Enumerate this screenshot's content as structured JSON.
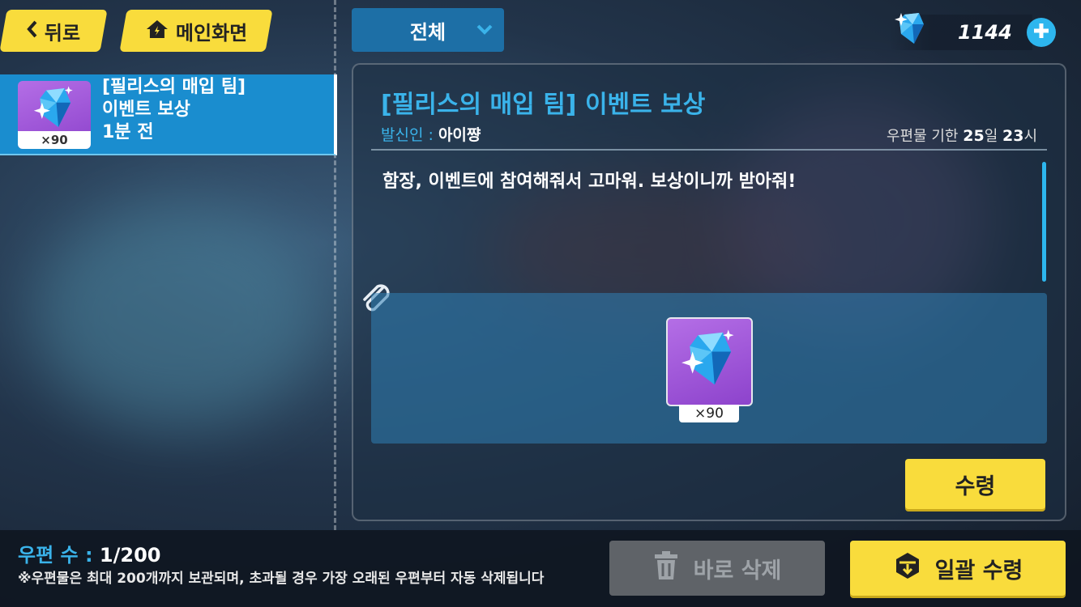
{
  "nav": {
    "back_label": "뒤로",
    "home_label": "메인화면"
  },
  "filter": {
    "selected": "전체"
  },
  "currency": {
    "amount": "1144",
    "icon": "crystal-icon"
  },
  "mail_list": [
    {
      "title_line1": "[필리스의 매입 팀]",
      "title_line2": "이벤트 보상",
      "time": "1분 전",
      "quantity": "×90",
      "icon": "crystal-icon"
    }
  ],
  "detail": {
    "title": "[필리스의 매입 팀] 이벤트 보상",
    "sender_label": "발신인 :",
    "sender_name": "아이쨩",
    "expire_prefix": "우편물 기한",
    "expire_days": "25",
    "expire_day_unit": "일",
    "expire_hours": "23",
    "expire_hour_unit": "시",
    "message": "함장, 이벤트에 참여해줘서 고마워. 보상이니까 받아줘!",
    "attachment": {
      "quantity": "×90",
      "icon": "crystal-icon"
    },
    "claim_label": "수령"
  },
  "footer": {
    "count_label": "우편 수 :",
    "count_value": "1/200",
    "notice": "※우편물은 최대 200개까지 보관되며, 초과될 경우 가장 오래된 우편부터 자동 삭제됩니다",
    "delete_label": "바로 삭제",
    "claim_all_label": "일괄 수령"
  },
  "colors": {
    "accent_yellow": "#f9dc3c",
    "accent_blue": "#3ab3ea",
    "selected_item": "#1a8dcf"
  }
}
